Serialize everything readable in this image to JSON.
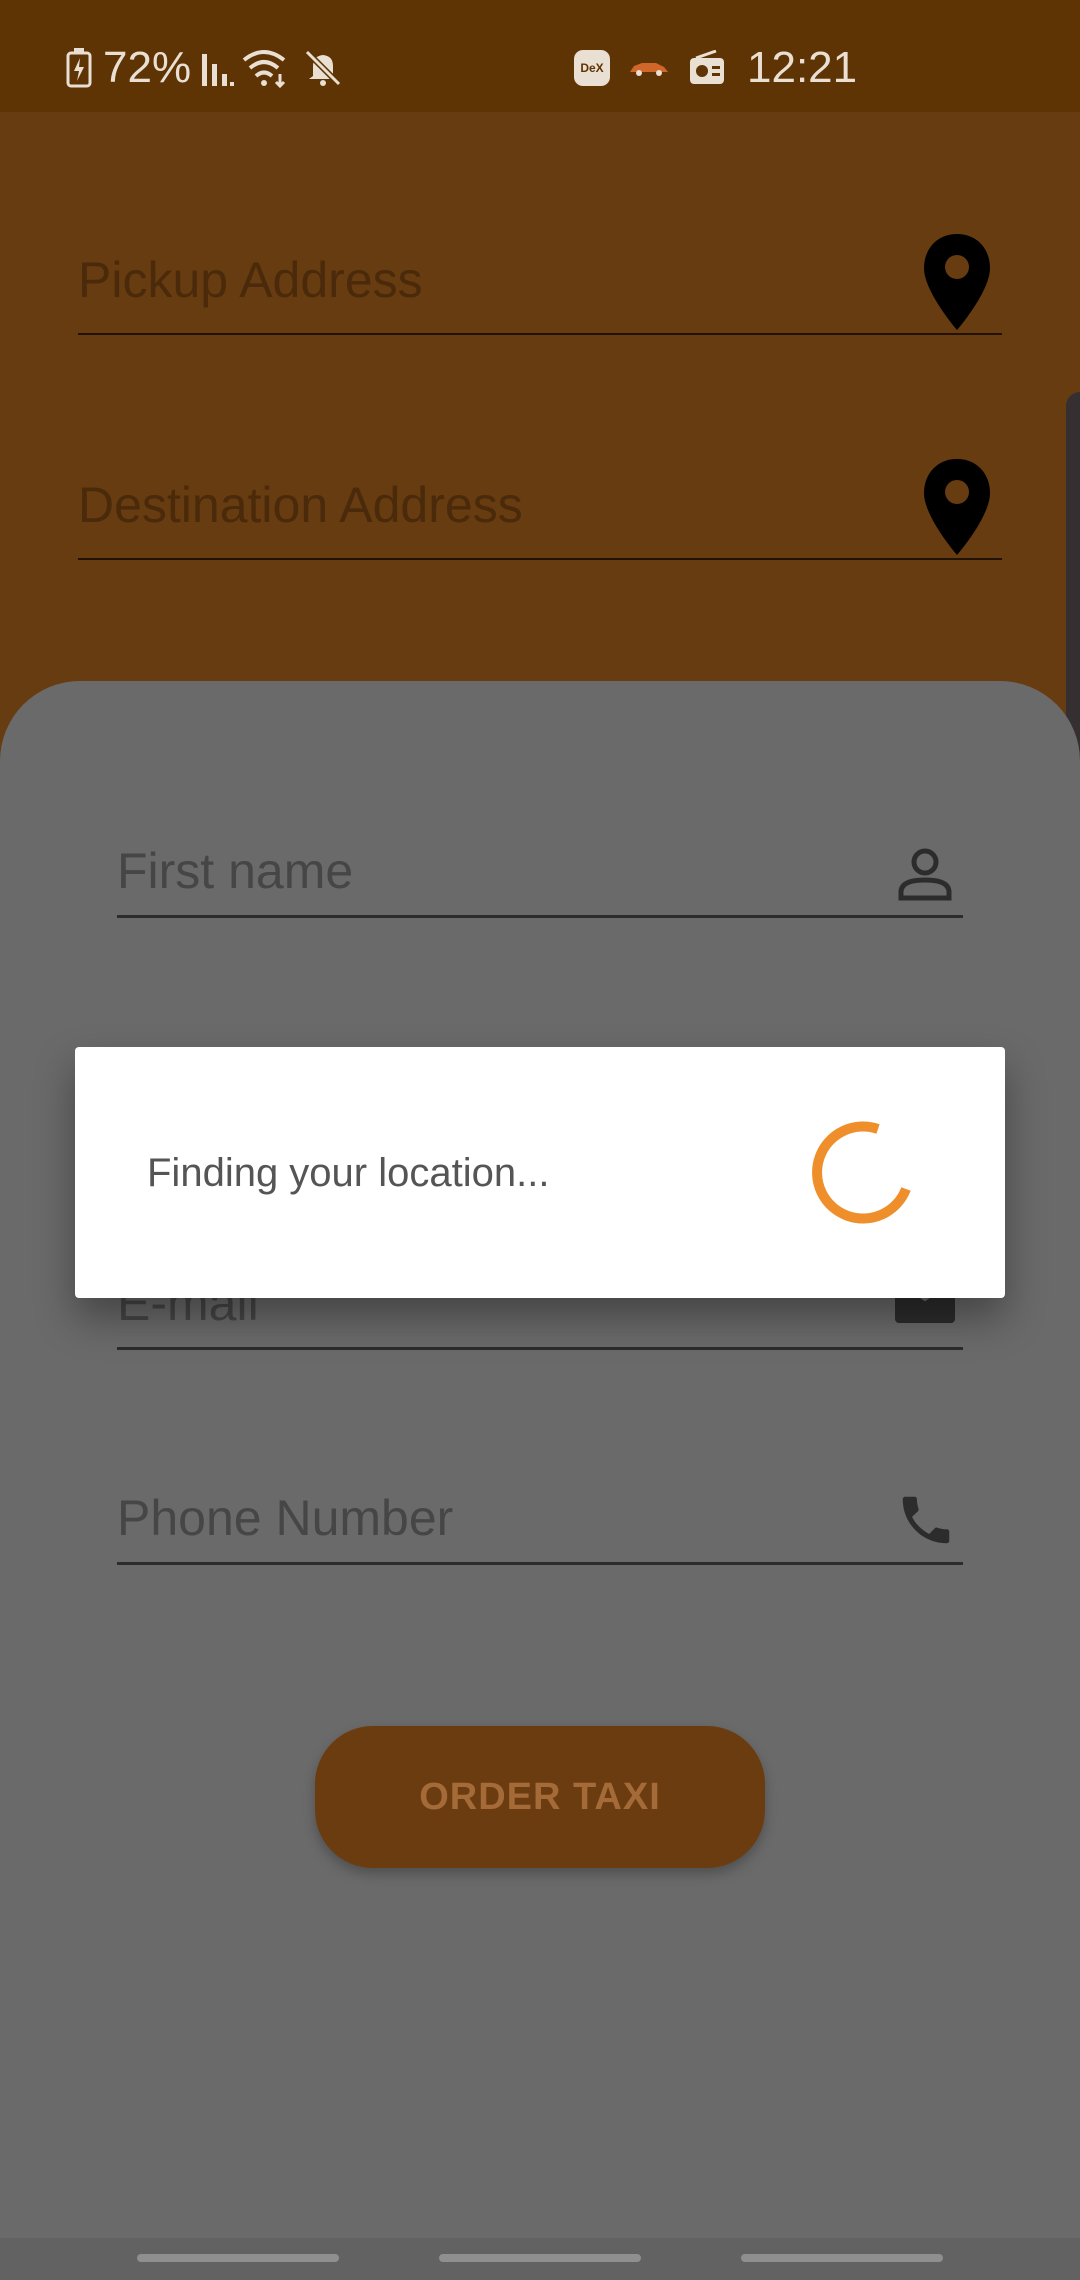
{
  "status_bar": {
    "battery": "72%",
    "time": "12:21",
    "dex_badge": "DeX",
    "icons": [
      "battery-charging-icon",
      "signal-icon",
      "wifi-icon",
      "mute-icon",
      "dex-icon",
      "car-icon",
      "radio-icon"
    ]
  },
  "address": {
    "pickup_placeholder": "Pickup Address",
    "destination_placeholder": "Destination Address",
    "pin_icon": "location-pin-icon"
  },
  "form": {
    "first_name_placeholder": "First name",
    "email_placeholder": "E-mail",
    "phone_placeholder": "Phone Number",
    "first_name_icon": "person-icon",
    "email_icon": "mail-icon",
    "phone_icon": "phone-icon"
  },
  "order_button": {
    "label": "ORDER TAXI"
  },
  "dialog": {
    "message": "Finding your location...",
    "spinner_icon": "loading-spinner-icon"
  },
  "colors": {
    "accent": "#ef8f2b",
    "brand_brown": "#673c10",
    "status_bar": "#5f3404"
  }
}
